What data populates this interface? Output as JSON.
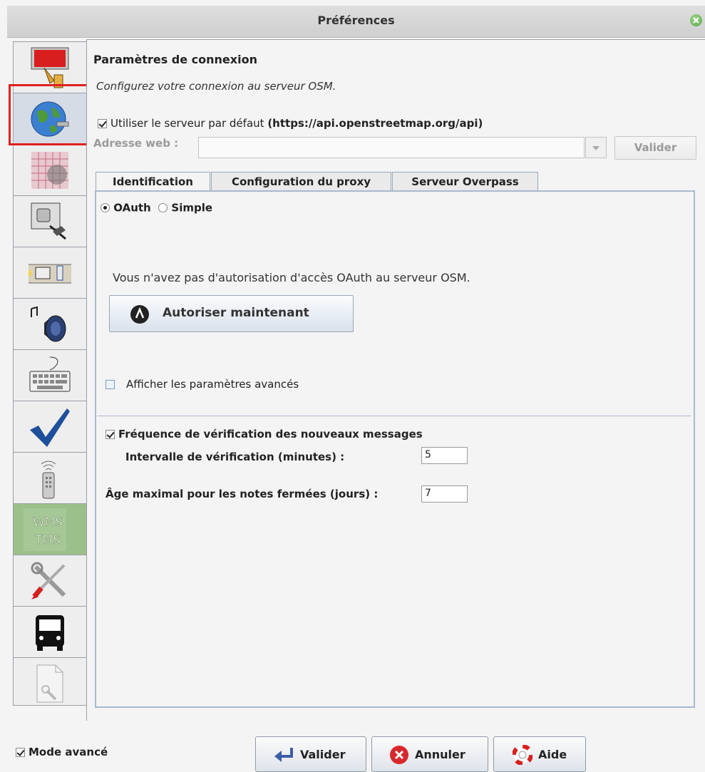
{
  "window": {
    "title": "Préférences"
  },
  "section": {
    "title": "Paramètres de connexion",
    "description": "Configurez votre connexion au serveur OSM."
  },
  "server": {
    "use_default_label": "Utiliser le serveur par défaut",
    "default_url": "(https://api.openstreetmap.org/api)",
    "use_default_checked": true,
    "url_label": "Adresse web :",
    "url_value": "",
    "validate_label": "Valider"
  },
  "tabs": [
    {
      "label": "Identification",
      "active": true
    },
    {
      "label": "Configuration du proxy",
      "active": false
    },
    {
      "label": "Serveur Overpass",
      "active": false
    }
  ],
  "auth": {
    "oauth_label": "OAuth",
    "simple_label": "Simple",
    "selected": "OAuth",
    "no_auth_message": "Vous n'avez pas d'autorisation d'accès OAuth au serveur OSM.",
    "authorize_label": "Autoriser maintenant",
    "advanced_label": "Afficher les paramètres avancés",
    "advanced_checked": false
  },
  "messages": {
    "check_label": "Fréquence de vérification des nouveaux messages",
    "check_checked": true,
    "interval_label": "Intervalle de vérification (minutes) :",
    "interval_value": "5",
    "notes_age_label": "Âge maximal pour les notes fermées (jours) :",
    "notes_age_value": "7"
  },
  "sidebar": {
    "items": [
      {
        "icon": "paint-icon",
        "selected": false
      },
      {
        "icon": "globe-icon",
        "selected": true
      },
      {
        "icon": "map-grid-icon",
        "selected": false
      },
      {
        "icon": "plugin-icon",
        "selected": false
      },
      {
        "icon": "toolbar-icon",
        "selected": false
      },
      {
        "icon": "audio-icon",
        "selected": false
      },
      {
        "icon": "keyboard-icon",
        "selected": false
      },
      {
        "icon": "validator-icon",
        "selected": false
      },
      {
        "icon": "remote-control-icon",
        "selected": false
      },
      {
        "icon": "wms-tms-icon",
        "selected": false,
        "text1": "WMS",
        "text2": "TMS"
      },
      {
        "icon": "tools-icon",
        "selected": false
      },
      {
        "icon": "bus-icon",
        "selected": false
      },
      {
        "icon": "advanced-file-icon",
        "selected": false
      }
    ]
  },
  "footer": {
    "expert_mode_label": "Mode avancé",
    "expert_mode_checked": true,
    "ok_label": "Valider",
    "cancel_label": "Annuler",
    "help_label": "Aide"
  },
  "colors": {
    "selection_highlight": "#e0201f",
    "tab_border": "#aab9cf"
  }
}
